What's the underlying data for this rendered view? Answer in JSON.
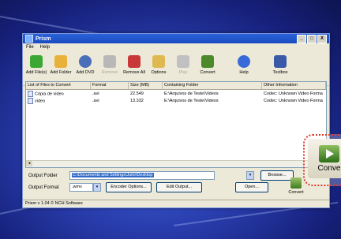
{
  "window": {
    "title": "Prism",
    "min_btn": "_",
    "max_btn": "□",
    "close_btn": "X"
  },
  "menu": [
    "File",
    "Help"
  ],
  "toolbar": {
    "items": [
      {
        "label": "Add File(s)",
        "icon": "add-file-icon",
        "color": "#3aa832",
        "disabled": false
      },
      {
        "label": "Add Folder",
        "icon": "add-folder-icon",
        "color": "#e8b23a",
        "disabled": false
      },
      {
        "label": "Add DVD",
        "icon": "dvd-icon",
        "color": "#4a6fb8",
        "disabled": false
      },
      {
        "label": "Remove",
        "icon": "remove-icon",
        "color": "#a0a0a0",
        "disabled": true
      },
      {
        "label": "Remove All",
        "icon": "remove-all-icon",
        "color": "#c83838",
        "disabled": false
      },
      {
        "label": "Options",
        "icon": "options-icon",
        "color": "#e0b850",
        "disabled": false
      },
      {
        "label": "Play",
        "icon": "play-icon",
        "color": "#b0b0b0",
        "disabled": true
      },
      {
        "label": "Convert",
        "icon": "convert-icon",
        "color": "#4a8a2a",
        "disabled": false
      },
      {
        "label": "Help",
        "icon": "help-icon",
        "color": "#3a6ad8",
        "disabled": false
      },
      {
        "label": "Toolbox",
        "icon": "toolbox-icon",
        "color": "#3a5aa8",
        "disabled": false
      }
    ]
  },
  "list": {
    "headers": [
      "List of Files to Convert",
      "Format",
      "Size (MB)",
      "Containing Folder",
      "Other Information"
    ],
    "rows": [
      [
        "Cópia de video",
        ".avi",
        "22.549",
        "E:\\Arquivos de Teste\\Videos",
        "Codec: Unknown Video Forma"
      ],
      [
        "video",
        ".avi",
        "13.332",
        "E:\\Arquivos de Teste\\Videos",
        "Codec: Unknown Video Forma"
      ]
    ]
  },
  "output": {
    "folder_label": "Output Folder",
    "folder_value": "C:\\Documents and Settings\\Julio\\Desktop",
    "browse": "Browse...",
    "format_label": "Output Format",
    "format_value": ".wmv",
    "encoder_options": "Encoder Options...",
    "edit_output": "Edit Output...",
    "open": "Open...",
    "convert": "Convert"
  },
  "status": "Prism v 1.04 © NCH Software",
  "callout_convert": "Conve"
}
